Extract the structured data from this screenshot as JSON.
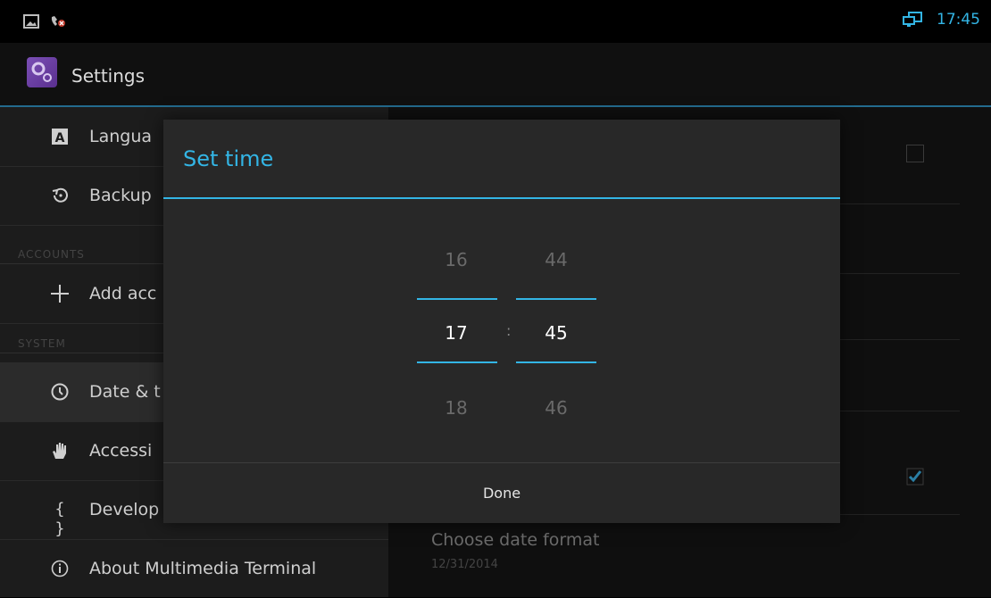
{
  "status_bar": {
    "time": "17:45"
  },
  "action_bar": {
    "title": "Settings"
  },
  "settings_list": {
    "items": [
      {
        "label": "Langua",
        "icon": "language-icon"
      },
      {
        "label": "Backup",
        "icon": "backup-restore-icon"
      },
      {
        "label": "Add acc",
        "icon": "add-icon"
      },
      {
        "label": "Date & t",
        "icon": "clock-icon"
      },
      {
        "label": "Accessi",
        "icon": "hand-icon"
      },
      {
        "label": "Develop",
        "icon": "braces-icon"
      },
      {
        "label": "About Multimedia Terminal",
        "icon": "info-icon"
      }
    ],
    "sections": [
      "ACCOUNTS",
      "SYSTEM"
    ]
  },
  "right_pane": {
    "choose_date_format": {
      "title": "Choose date format",
      "value": "12/31/2014"
    }
  },
  "dialog": {
    "title": "Set time",
    "hour": {
      "prev": "16",
      "current": "17",
      "next": "18"
    },
    "minute": {
      "prev": "44",
      "current": "45",
      "next": "46"
    },
    "separator": ":",
    "done_label": "Done"
  },
  "colors": {
    "accent": "#33b5e5",
    "dialog_bg": "#282828"
  }
}
